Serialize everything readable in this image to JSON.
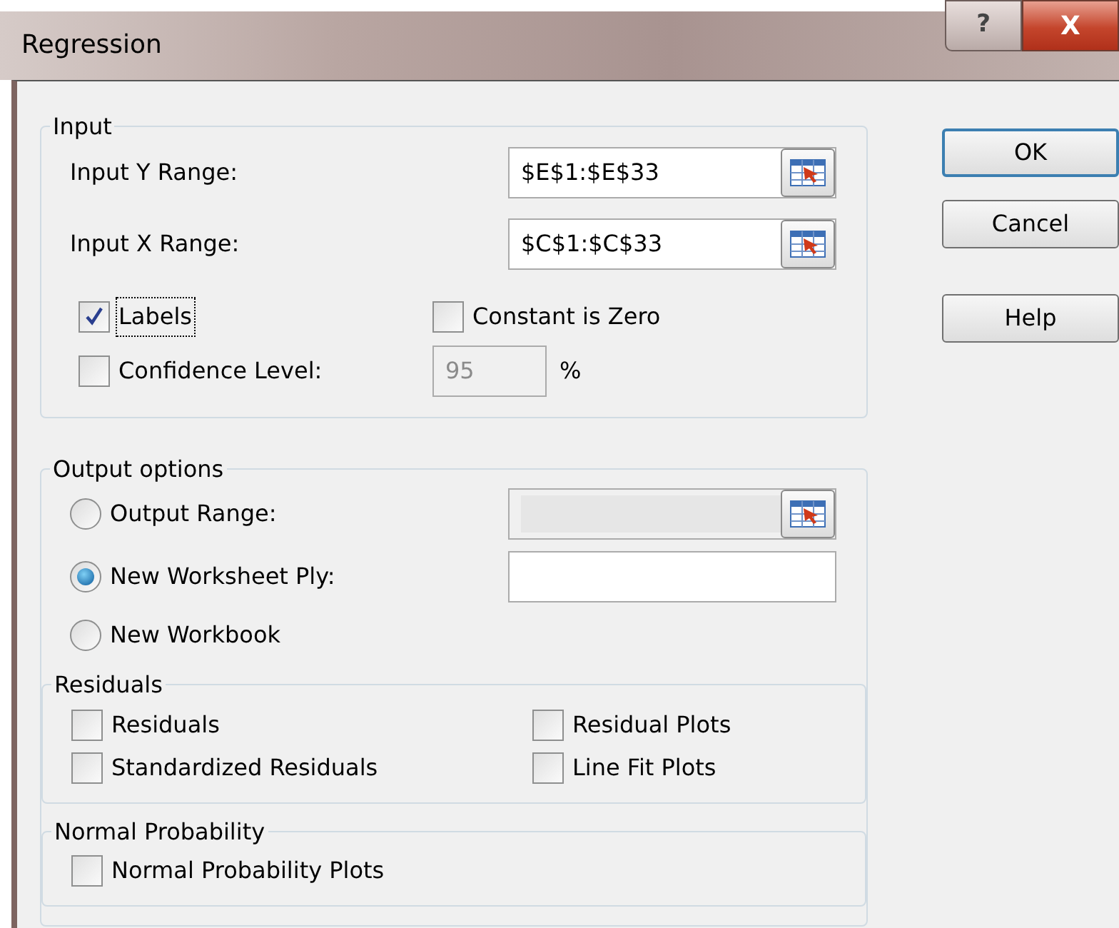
{
  "window": {
    "title": "Regression",
    "help_button": "?",
    "close_button": "X"
  },
  "input": {
    "title": "Input",
    "ranges": [
      {
        "label": "Input Y Range:",
        "value": "$E$1:$E$33"
      },
      {
        "label": "Input X Range:",
        "value": "$C$1:$C$33"
      }
    ],
    "labels": {
      "label": "Labels",
      "checked": true,
      "focused": true
    },
    "constant_is_zero": {
      "label": "Constant is Zero",
      "checked": false
    },
    "confidence": {
      "label": "Confidence Level:",
      "checked": false,
      "value": "95",
      "disabled": true,
      "unit": "%"
    }
  },
  "output": {
    "title": "Output options",
    "choices": [
      {
        "kind": "range",
        "label": "Output Range:",
        "selected": false,
        "disabled": true
      },
      {
        "kind": "field",
        "label": "New Worksheet Ply:",
        "selected": true,
        "disabled": false
      },
      {
        "kind": "plain",
        "label": "New Workbook",
        "selected": false
      }
    ]
  },
  "residuals": {
    "title": "Residuals",
    "options": [
      {
        "label": "Residuals",
        "checked": false
      },
      {
        "label": "Residual Plots",
        "checked": false
      },
      {
        "label": "Standardized Residuals",
        "checked": false
      },
      {
        "label": "Line Fit Plots",
        "checked": false
      }
    ]
  },
  "normal_probability": {
    "title": "Normal Probability",
    "options": [
      {
        "label": "Normal Probability Plots",
        "checked": false
      }
    ]
  },
  "buttons": [
    {
      "label": "OK",
      "default": true
    },
    {
      "label": "Cancel",
      "default": false
    },
    {
      "label": "Help",
      "default": false
    }
  ]
}
